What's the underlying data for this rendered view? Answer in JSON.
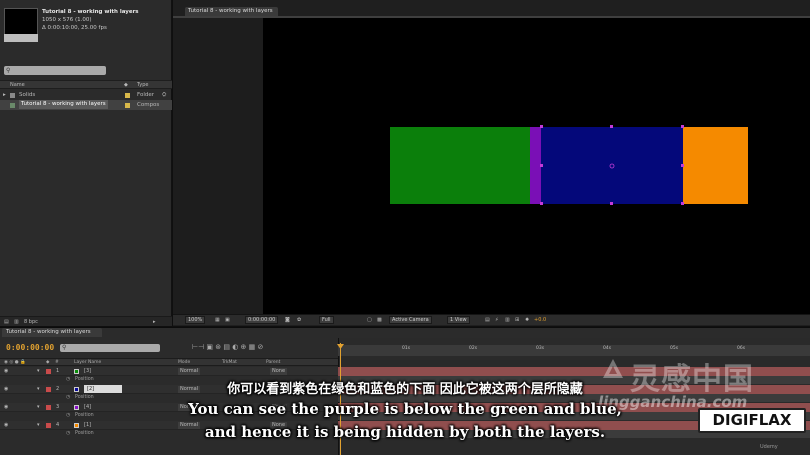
{
  "project": {
    "comp_name": "Tutorial 8 - working with layers",
    "comp_size": "1050 x 576 (1.00)",
    "comp_duration": "Δ 0:00:10:00, 25.00 fps",
    "col_name": "Name",
    "col_type": "Type",
    "items": [
      {
        "name": "Solids",
        "type": "Folder",
        "color": "#d8b84a"
      },
      {
        "name": "Tutorial 8 - working with layers",
        "type": "Compos",
        "color": "#d8b84a"
      }
    ],
    "bit_depth": "8 bpc"
  },
  "viewer": {
    "tab": "Tutorial 8 - working with layers",
    "zoom": "100%",
    "timecode": "0:00:00:00",
    "resolution": "Full",
    "camera": "Active Camera",
    "views": "1 View",
    "exposure": "+0.0",
    "rects": {
      "green": "#0b7f0b",
      "purple": "#7a0fb6",
      "blue": "#04087a",
      "orange": "#f58a00"
    }
  },
  "timeline": {
    "tab": "Tutorial 8 - working with layers",
    "timecode": "0:00:00:00",
    "col_layer_name": "Layer Name",
    "col_mode": "Mode",
    "col_trkmat": "TrkMat",
    "col_parent": "Parent",
    "ruler_ticks": [
      "01s",
      "02s",
      "03s",
      "04s",
      "05s",
      "06s"
    ],
    "layers": [
      {
        "num": "1",
        "name": "[3]",
        "color": "#0b8f0b",
        "mode": "Normal",
        "parent": "None",
        "prop": "Position"
      },
      {
        "num": "2",
        "name": "[2]",
        "color": "#0a0a9a",
        "mode": "Normal",
        "parent": "None",
        "prop": "Position"
      },
      {
        "num": "3",
        "name": "[4]",
        "color": "#8a12c8",
        "mode": "Normal",
        "parent": "None",
        "prop": "Position"
      },
      {
        "num": "4",
        "name": "[1]",
        "color": "#f58a00",
        "mode": "Normal",
        "parent": "None",
        "prop": "Position"
      }
    ]
  },
  "subtitles": {
    "cn": "你可以看到紫色在绿色和蓝色的下面 因此它被这两个层所隐藏",
    "en1": "You can see the purple is below the green and blue,",
    "en2": "and hence it is being hidden by both the layers."
  },
  "watermarks": {
    "cn": "灵感中国",
    "url": "lingganchina.com",
    "brand": "DIGIFLAX",
    "udemy": "Udemy"
  }
}
